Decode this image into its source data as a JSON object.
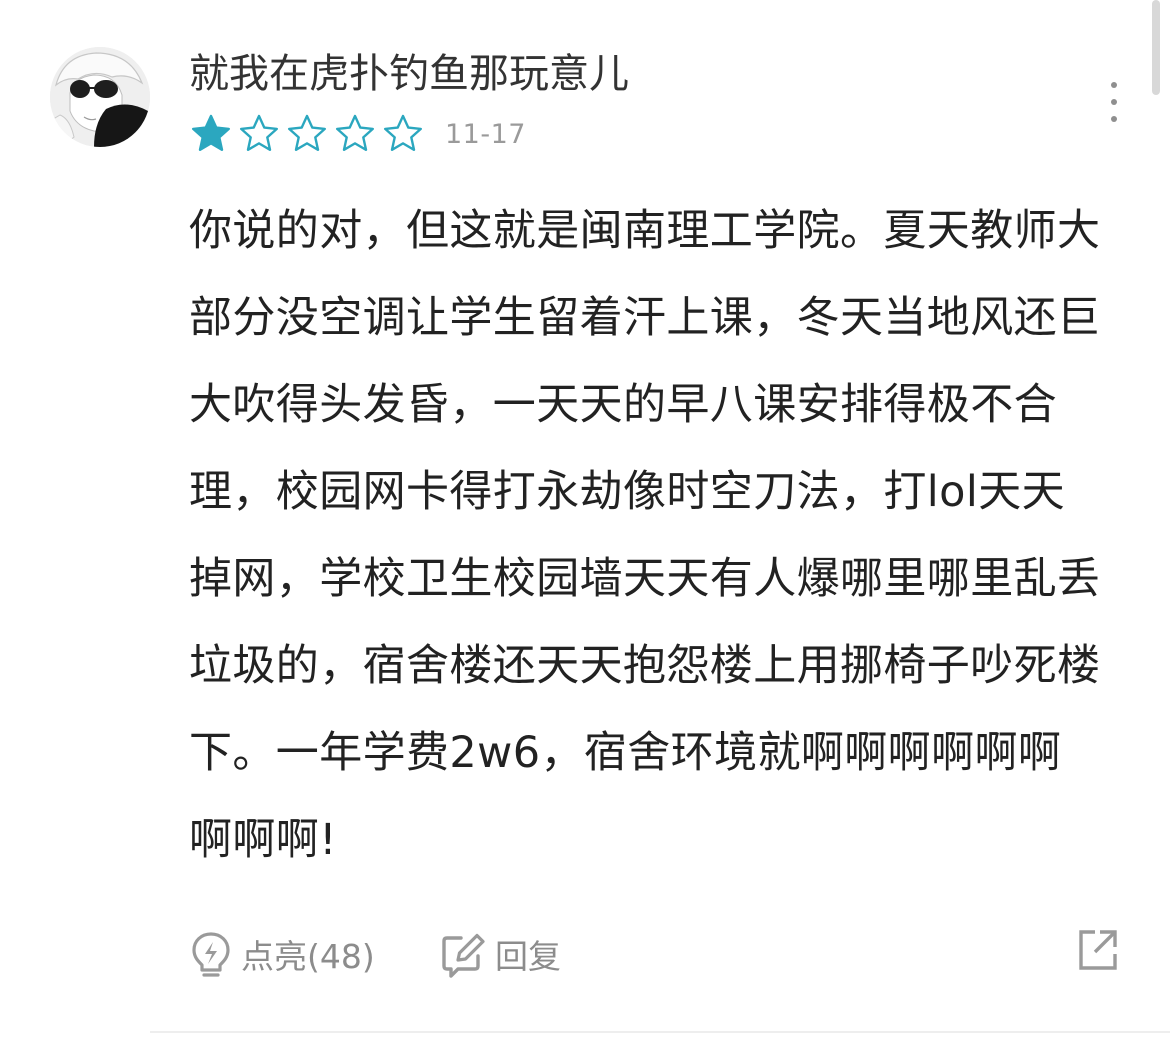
{
  "review": {
    "user": {
      "name": "就我在虎扑钓鱼那玩意儿",
      "avatar_icon": "anime-avatar"
    },
    "rating": {
      "value": 1,
      "max": 5,
      "filled_color": "#2ba7bf",
      "empty_color": "#2ba7bf"
    },
    "date": "11-17",
    "content": "你说的对，但这就是闽南理工学院。夏天教师大部分没空调让学生留着汗上课，冬天当地风还巨大吹得头发昏，一天天的早八课安排得极不合理，校园网卡得打永劫像时空刀法，打lol天天掉网，学校卫生校园墙天天有人爆哪里哪里乱丢垃圾的，宿舍楼还天天抱怨楼上用挪椅子吵死楼下。一年学费2w6，宿舍环境就啊啊啊啊啊啊啊啊啊!",
    "actions": {
      "like_label": "点亮(48)",
      "like_icon": "lightbulb-icon",
      "reply_label": "回复",
      "reply_icon": "edit-icon",
      "share_icon": "share-icon",
      "more_icon": "more-vertical-icon"
    }
  }
}
